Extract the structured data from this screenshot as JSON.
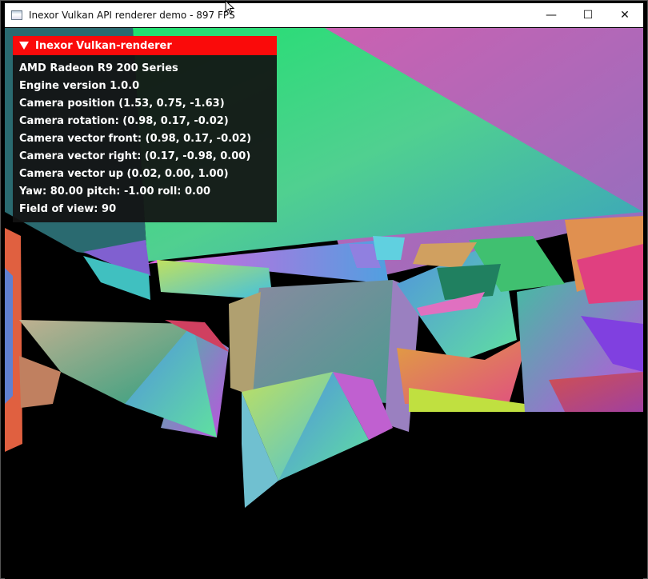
{
  "window": {
    "title": "Inexor Vulkan API renderer demo - 897 FPS",
    "controls": {
      "minimize": "—",
      "maximize": "☐",
      "close": "✕"
    }
  },
  "overlay": {
    "header": "Inexor Vulkan-renderer",
    "lines": [
      "AMD Radeon R9 200 Series",
      "Engine version 1.0.0",
      "Camera position (1.53, 0.75, -1.63)",
      "Camera rotation: (0.98, 0.17, -0.02)",
      "Camera vector front: (0.98, 0.17, -0.02)",
      "Camera vector right: (0.17, -0.98, 0.00)",
      "Camera vector up (0.02, 0.00, 1.00)",
      "Yaw: 80.00 pitch: -1.00 roll: 0.00",
      "Field of view: 90"
    ],
    "accent_color": "#fa0a0a"
  },
  "icons": {
    "app": "window-app-icon",
    "cursor": "mouse-cursor-icon"
  }
}
